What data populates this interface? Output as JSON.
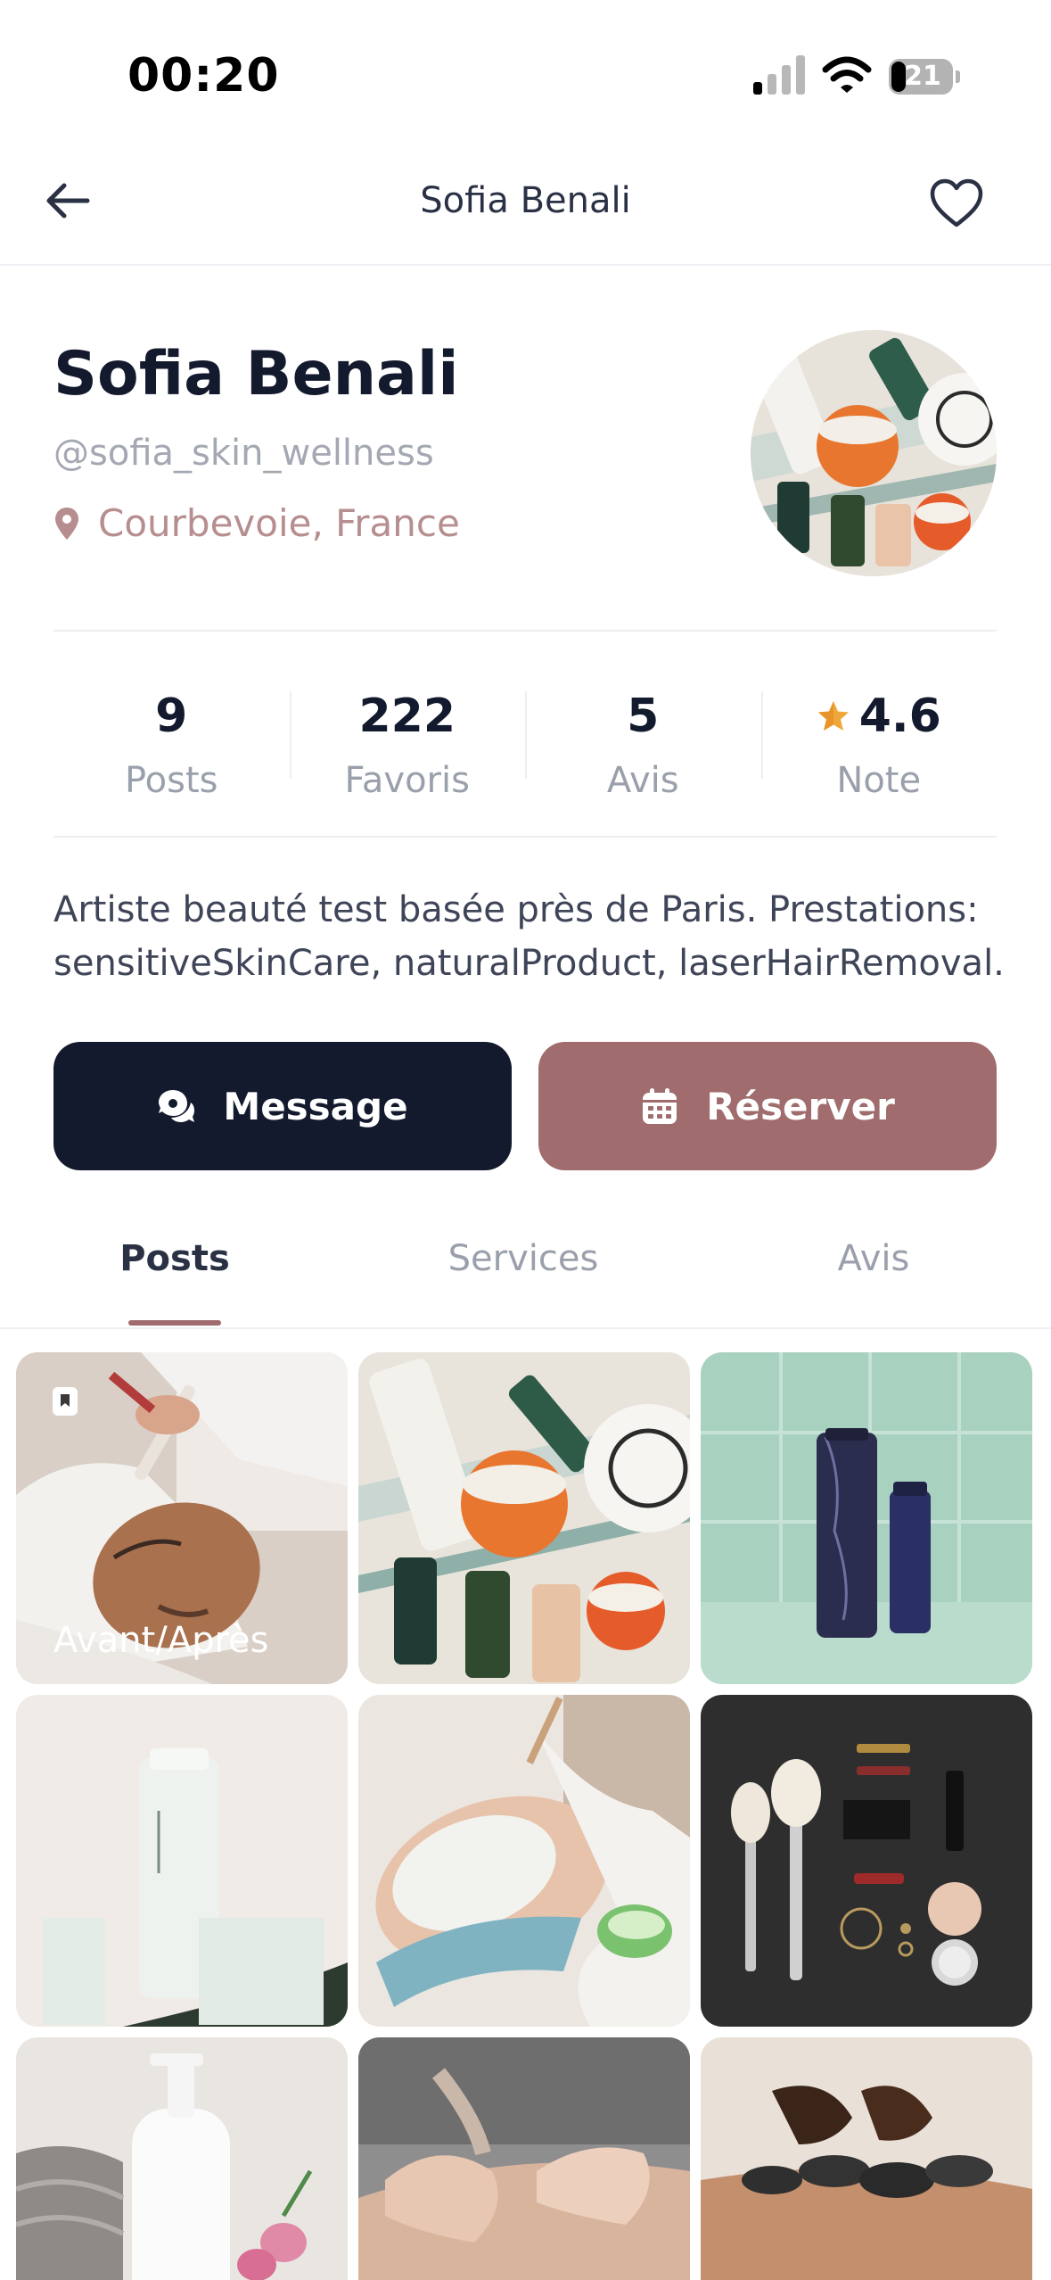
{
  "status_bar": {
    "time": "00:20",
    "battery": "21",
    "icons": [
      "cellular-signal-icon",
      "wifi-icon",
      "battery-icon"
    ]
  },
  "nav": {
    "title": "Sofia Benali",
    "back_icon": "arrow-left-icon",
    "favorite_icon": "heart-outline-icon"
  },
  "profile": {
    "name": "Sofia Benali",
    "handle": "@sofia_skin_wellness",
    "location": "Courbevoie, France",
    "bio": "Artiste beauté test basée près de Paris. Prestations: sensitiveSkinCare, naturalProduct, laserHairRemoval."
  },
  "stats": [
    {
      "value": "9",
      "label": "Posts"
    },
    {
      "value": "222",
      "label": "Favoris"
    },
    {
      "value": "5",
      "label": "Avis"
    },
    {
      "value": "4.6",
      "label": "Note"
    }
  ],
  "actions": {
    "message_label": "Message",
    "book_label": "Réserver"
  },
  "tabs": [
    {
      "label": "Posts",
      "active": true
    },
    {
      "label": "Services",
      "active": false
    },
    {
      "label": "Avis",
      "active": false
    }
  ],
  "posts": [
    {
      "caption": "Avant/Après",
      "subject": "facial-mask-treatment"
    },
    {
      "caption": "",
      "subject": "skincare-flatlay"
    },
    {
      "caption": "",
      "subject": "product-bottles-tiles"
    },
    {
      "caption": "",
      "subject": "hair-mask-tube"
    },
    {
      "caption": "",
      "subject": "facial-cleansing"
    },
    {
      "caption": "",
      "subject": "makeup-brushes-flatlay"
    },
    {
      "caption": "",
      "subject": "pump-bottle-towel"
    },
    {
      "caption": "",
      "subject": "back-massage"
    },
    {
      "caption": "",
      "subject": "hot-stone-massage"
    }
  ],
  "colors": {
    "primary_dark": "#141a2e",
    "accent_rose": "#a06c6d",
    "location_rose": "#b78e8f",
    "star": "#f0a73a"
  }
}
